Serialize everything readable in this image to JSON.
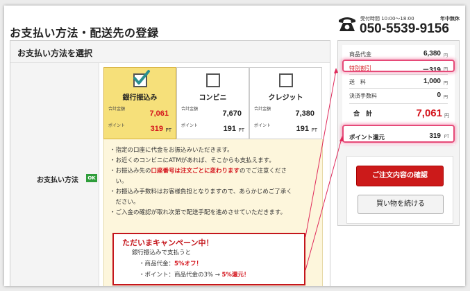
{
  "page": {
    "title": "お支払い方法・配送先の登録"
  },
  "phone": {
    "hours": "受付時間 10:00～18:00",
    "holiday": "年中無休",
    "number": "050-5539-9156",
    "icon": "phone-icon"
  },
  "payment": {
    "heading": "お支払い方法を選択",
    "method_label": "お支払い方法",
    "ok_badge": "OK",
    "total_caption": "合計金額",
    "point_caption": "ポイント",
    "pt_unit": "PT",
    "options": [
      {
        "label": "銀行振込み",
        "selected": true,
        "total": "7,061",
        "points": "319",
        "icon": "checkbox-checked-icon"
      },
      {
        "label": "コンビニ",
        "selected": false,
        "total": "7,670",
        "points": "191",
        "icon": "checkbox-icon"
      },
      {
        "label": "クレジット",
        "selected": false,
        "total": "7,380",
        "points": "191",
        "icon": "checkbox-icon"
      }
    ],
    "notes": {
      "line1": "・指定の口座に代金をお振込みいただきます。",
      "line2": "・お近くのコンビニにATMがあれば、そこからも支払えます。",
      "line3_pre": "・お振込み先の",
      "line3_hl": "口座番号は注文ごとに変わります",
      "line3_post": "のでご注意くださ",
      "line3_cont": "　い。",
      "line4": "・お振込み手数料はお客様負担となりますので、あらかじめご了承く",
      "line4_cont": "　ださい。",
      "line5": "・ご入金の確認が取れ次第で配送手配を進めさせていただきます。"
    },
    "campaign": {
      "title": "ただいまキャンペーン中！",
      "line1": "銀行振込みで支払うと",
      "line2_pre": "・商品代金：",
      "line2_hl": "5%オフ！",
      "line3_pre": "・ポイント：商品代金の3% → ",
      "line3_hl": "5%還元！"
    }
  },
  "summary": {
    "yen": "円",
    "rows": [
      {
        "label": "商品代金",
        "value": "6,380"
      },
      {
        "label": "特別割引",
        "value": "－319"
      },
      {
        "label": "送　料",
        "value": "1,000"
      },
      {
        "label": "決済手数料",
        "value": "0"
      }
    ],
    "total_label": "合　計",
    "total_value": "7,061",
    "points_label": "ポイント還元",
    "points_value": "319",
    "points_unit": "PT",
    "confirm_button": "ご注文内容の確認",
    "continue_button": "買い物を続ける"
  },
  "colors": {
    "accent_red": "#d4141c",
    "selected_yellow": "#f6e07a",
    "ok_green": "#2e9d3a",
    "highlight_pink": "#e64a78"
  }
}
